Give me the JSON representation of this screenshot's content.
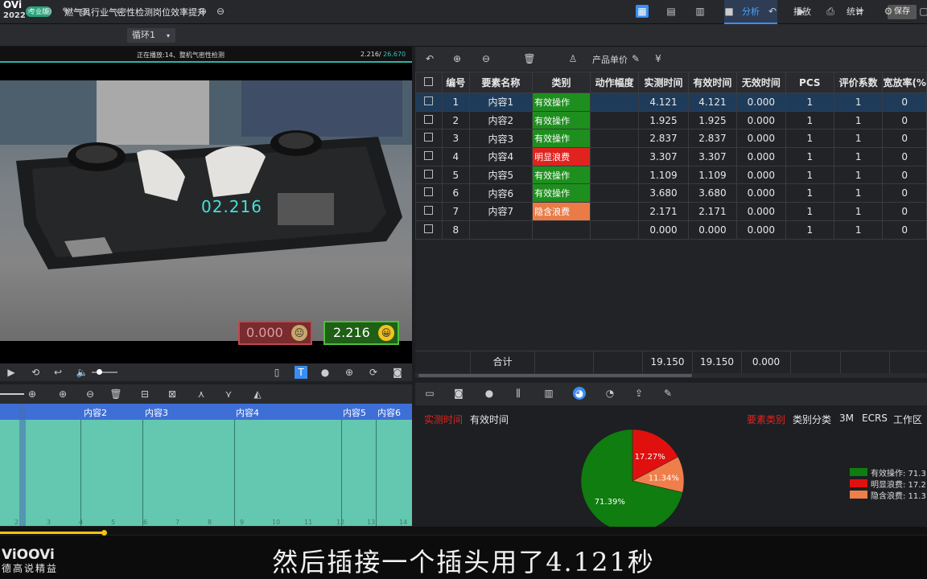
{
  "app": {
    "logo": "OVi",
    "year": "2022",
    "badge": "专业版",
    "title": "燃气具行业气密性检测岗位效率提升"
  },
  "top_tabs": {
    "analyze": "分析",
    "play": "播放",
    "stats": "统计",
    "save": "保存"
  },
  "toolbar": {
    "loop": "循环1"
  },
  "video": {
    "playing_title": "正在播放:14、整机气密性检测",
    "time_current": "2.216",
    "time_total": "26.670",
    "timer_overlay": "02.216",
    "score_bad": "0.000",
    "score_good": "2.216"
  },
  "table_toolbar": {
    "unit_price_label": "产品单价"
  },
  "table": {
    "headers": [
      "编号",
      "要素名称",
      "类别",
      "动作幅度",
      "实测时间",
      "有效时间",
      "无效时间",
      "PCS",
      "评价系数",
      "宽放率(%"
    ],
    "rows": [
      {
        "no": "1",
        "name": "内容1",
        "category": "有效操作",
        "cat_type": "green",
        "amp": "",
        "measured": "4.121",
        "effective": "4.121",
        "invalid": "0.000",
        "pcs": "1",
        "coef": "1",
        "allow": "0"
      },
      {
        "no": "2",
        "name": "内容2",
        "category": "有效操作",
        "cat_type": "green",
        "amp": "",
        "measured": "1.925",
        "effective": "1.925",
        "invalid": "0.000",
        "pcs": "1",
        "coef": "1",
        "allow": "0"
      },
      {
        "no": "3",
        "name": "内容3",
        "category": "有效操作",
        "cat_type": "green",
        "amp": "",
        "measured": "2.837",
        "effective": "2.837",
        "invalid": "0.000",
        "pcs": "1",
        "coef": "1",
        "allow": "0"
      },
      {
        "no": "4",
        "name": "内容4",
        "category": "明显浪费",
        "cat_type": "red",
        "amp": "",
        "measured": "3.307",
        "effective": "3.307",
        "invalid": "0.000",
        "pcs": "1",
        "coef": "1",
        "allow": "0"
      },
      {
        "no": "5",
        "name": "内容5",
        "category": "有效操作",
        "cat_type": "green",
        "amp": "",
        "measured": "1.109",
        "effective": "1.109",
        "invalid": "0.000",
        "pcs": "1",
        "coef": "1",
        "allow": "0"
      },
      {
        "no": "6",
        "name": "内容6",
        "category": "有效操作",
        "cat_type": "green",
        "amp": "",
        "measured": "3.680",
        "effective": "3.680",
        "invalid": "0.000",
        "pcs": "1",
        "coef": "1",
        "allow": "0"
      },
      {
        "no": "7",
        "name": "内容7",
        "category": "隐含浪费",
        "cat_type": "orange",
        "amp": "",
        "measured": "2.171",
        "effective": "2.171",
        "invalid": "0.000",
        "pcs": "1",
        "coef": "1",
        "allow": "0"
      },
      {
        "no": "8",
        "name": "",
        "category": "",
        "cat_type": "",
        "amp": "",
        "measured": "0.000",
        "effective": "0.000",
        "invalid": "0.000",
        "pcs": "1",
        "coef": "1",
        "allow": "0"
      }
    ],
    "totals": {
      "label": "合计",
      "measured": "19.150",
      "effective": "19.150",
      "invalid": "0.000"
    }
  },
  "timeline": {
    "segments": [
      "内容2",
      "内容3",
      "内容4",
      "内容5",
      "内容6"
    ],
    "ticks": [
      "2",
      "3",
      "4",
      "5",
      "6",
      "7",
      "8",
      "9",
      "10",
      "11",
      "12",
      "13",
      "14"
    ]
  },
  "chart_tabs": {
    "left": [
      "实测时间",
      "有效时间"
    ],
    "right": [
      "要素类别",
      "类别分类",
      "3M",
      "ECRS",
      "工作区"
    ]
  },
  "chart_data": {
    "type": "pie",
    "labels": [
      "有效操作",
      "明显浪费",
      "隐含浪费"
    ],
    "values": [
      71.39,
      17.27,
      11.34
    ],
    "colors": [
      "#0f7d0f",
      "#e0100f",
      "#ef7e4b"
    ],
    "slice_labels": [
      "71.39%",
      "17.27%",
      "11.34%"
    ],
    "legend": [
      "有效操作: 71.3",
      "明显浪费: 17.2",
      "隐含浪费: 11.3"
    ]
  },
  "subtitle": "然后插接一个插头用了4.121秒",
  "brand": {
    "name": "ViOOVi",
    "slogan": "德高说精益"
  }
}
